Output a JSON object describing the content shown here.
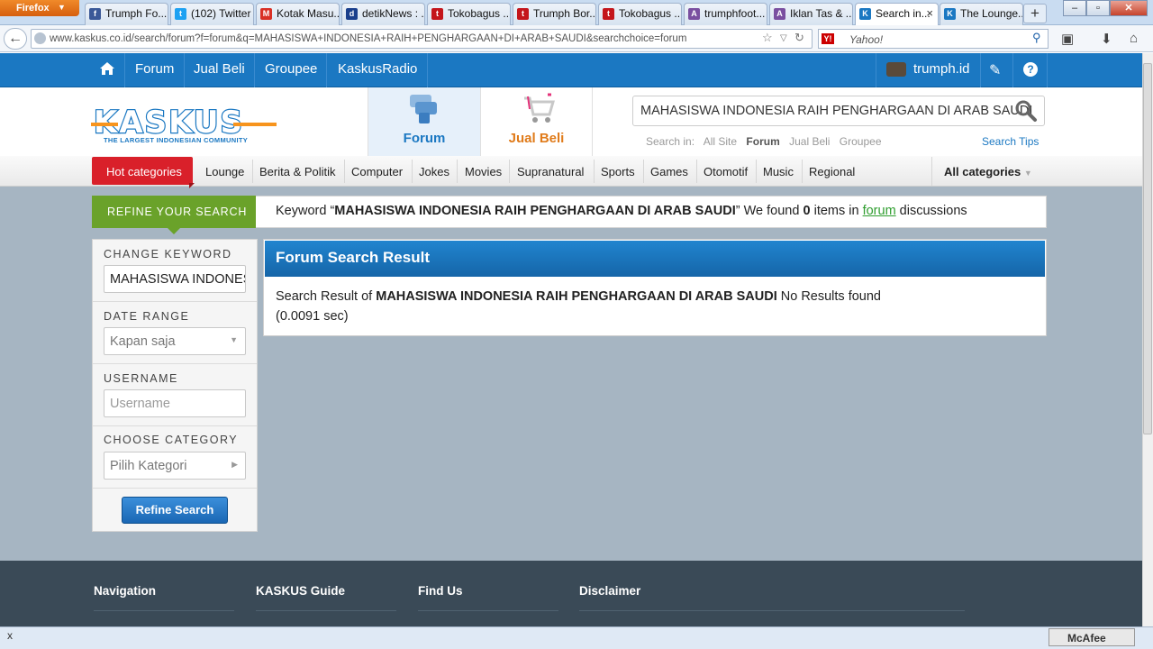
{
  "browser": {
    "app_button": "Firefox",
    "tabs": [
      {
        "label": "Trumph Fo...",
        "icon": "facebook-icon",
        "color": "#3b5998",
        "glyph": "f"
      },
      {
        "label": "(102) Twitter",
        "icon": "twitter-icon",
        "color": "#1da1f2",
        "glyph": "t"
      },
      {
        "label": "Kotak Masu...",
        "icon": "gmail-icon",
        "color": "#d93025",
        "glyph": "M"
      },
      {
        "label": "detikNews : ...",
        "icon": "detik-icon",
        "color": "#1a3f8c",
        "glyph": "d"
      },
      {
        "label": "Tokobagus ...",
        "icon": "tokobagus-icon",
        "color": "#c4161c",
        "glyph": "t"
      },
      {
        "label": "Trumph Bor...",
        "icon": "tokobagus-icon",
        "color": "#c4161c",
        "glyph": "t"
      },
      {
        "label": "Tokobagus ...",
        "icon": "tokobagus-icon",
        "color": "#c4161c",
        "glyph": "t"
      },
      {
        "label": "trumphfoot...",
        "icon": "site-icon",
        "color": "#7a4fa0",
        "glyph": "A"
      },
      {
        "label": "Iklan Tas & ...",
        "icon": "site-icon",
        "color": "#7a4fa0",
        "glyph": "A"
      },
      {
        "label": "Search in...",
        "icon": "kaskus-icon",
        "color": "#1b78c2",
        "glyph": "K",
        "active": true
      },
      {
        "label": "The Lounge...",
        "icon": "kaskus-icon",
        "color": "#1b78c2",
        "glyph": "K"
      }
    ],
    "url": "www.kaskus.co.id/search/forum?f=forum&q=MAHASISWA+INDONESIA+RAIH+PENGHARGAAN+DI+ARAB+SAUDI&searchchoice=forum",
    "search_engine_placeholder": "Yahoo!"
  },
  "topnav": {
    "items": [
      "Forum",
      "Jual Beli",
      "Groupee",
      "KaskusRadio"
    ],
    "username": "trumph.id"
  },
  "header": {
    "logo_text": "KASKUS",
    "logo_tagline": "THE LARGEST INDONESIAN COMMUNITY",
    "tab_forum": "Forum",
    "tab_jualbeli": "Jual Beli",
    "search_value": "MAHASISWA INDONESIA RAIH PENGHARGAAN DI ARAB SAUDI",
    "search_in_label": "Search in:",
    "search_in_options": [
      "All Site",
      "Forum",
      "Jual Beli",
      "Groupee"
    ],
    "search_in_selected": "Forum",
    "search_tips": "Search Tips"
  },
  "categories": {
    "hot": "Hot categories",
    "items": [
      "Lounge",
      "Berita & Politik",
      "Computer",
      "Jokes",
      "Movies",
      "Supranatural",
      "Sports",
      "Games",
      "Otomotif",
      "Music",
      "Regional"
    ],
    "all": "All categories"
  },
  "refine": {
    "label": "REFINE YOUR SEARCH",
    "prefix": "Keyword “",
    "keyword": "MAHASISWA INDONESIA RAIH PENGHARGAAN DI ARAB SAUDI",
    "middle": "” We found ",
    "count": "0",
    "items_in": " items in ",
    "link": "forum",
    "suffix": " discussions"
  },
  "sidebar": {
    "change_keyword_label": "CHANGE KEYWORD",
    "change_keyword_value": "MAHASISWA INDONESIA RAIH PENGHARGAAN DI ARAB SAUDI",
    "date_range_label": "DATE RANGE",
    "date_range_value": "Kapan saja",
    "username_label": "USERNAME",
    "username_placeholder": "Username",
    "category_label": "CHOOSE CATEGORY",
    "category_value": "Pilih Kategori",
    "refine_button": "Refine Search"
  },
  "result": {
    "title": "Forum Search Result",
    "prefix": "Search Result of ",
    "keyword": "MAHASISWA INDONESIA RAIH PENGHARGAAN DI ARAB SAUDI",
    "status": " No Results found",
    "time": "(0.0091 sec)"
  },
  "footer": {
    "columns": [
      "Navigation",
      "KASKUS Guide",
      "Find Us",
      "Disclaimer"
    ]
  },
  "addon": {
    "close": "x",
    "mcafee": "McAfee"
  },
  "colors": {
    "brand_blue": "#1b78c2",
    "brand_orange": "#f7941d",
    "hot_red": "#d9202a",
    "refine_green": "#6aa22a",
    "footer_bg": "#3a4a57"
  }
}
